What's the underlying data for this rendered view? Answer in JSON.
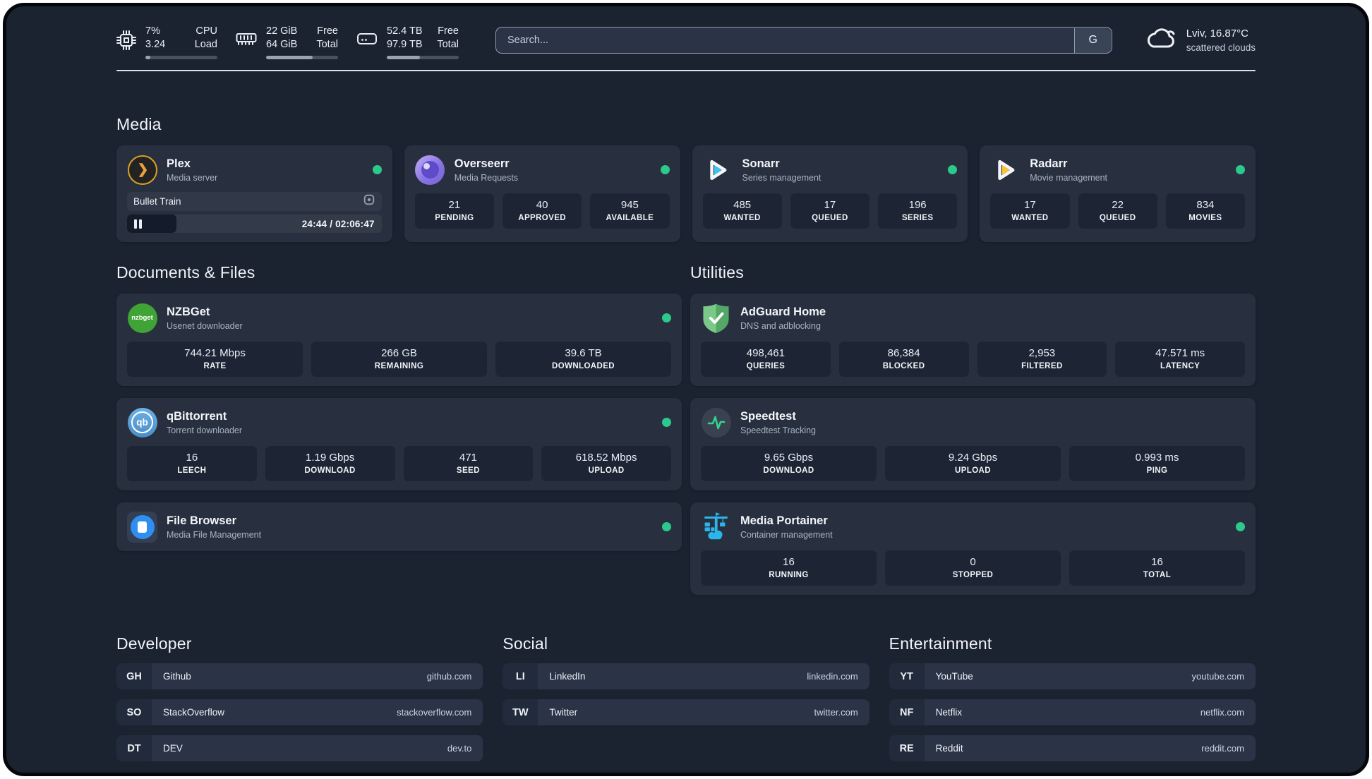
{
  "topbar": {
    "cpu": {
      "values": [
        "7%",
        "3.24"
      ],
      "labels": [
        "CPU",
        "Load"
      ],
      "progress": 7
    },
    "memory": {
      "values": [
        "22 GiB",
        "64 GiB"
      ],
      "labels": [
        "Free",
        "Total"
      ],
      "progress": 65
    },
    "disk": {
      "values": [
        "52.4 TB",
        "97.9 TB"
      ],
      "labels": [
        "Free",
        "Total"
      ],
      "progress": 46
    },
    "search": {
      "placeholder": "Search...",
      "button_label": "G"
    },
    "weather": {
      "location": "Lviv, 16.87°C",
      "condition": "scattered clouds"
    }
  },
  "sections": {
    "media": {
      "title": "Media"
    },
    "documents": {
      "title": "Documents & Files"
    },
    "utilities": {
      "title": "Utilities"
    },
    "developer": {
      "title": "Developer"
    },
    "social": {
      "title": "Social"
    },
    "entertainment": {
      "title": "Entertainment"
    }
  },
  "services": {
    "plex": {
      "name": "Plex",
      "description": "Media server",
      "player": {
        "title": "Bullet Train",
        "time_display": "24:44 / 02:06:47",
        "progress": 19.5
      }
    },
    "overseerr": {
      "name": "Overseerr",
      "description": "Media Requests",
      "stats": [
        {
          "value": "21",
          "label": "PENDING"
        },
        {
          "value": "40",
          "label": "APPROVED"
        },
        {
          "value": "945",
          "label": "AVAILABLE"
        }
      ]
    },
    "sonarr": {
      "name": "Sonarr",
      "description": "Series management",
      "stats": [
        {
          "value": "485",
          "label": "WANTED"
        },
        {
          "value": "17",
          "label": "QUEUED"
        },
        {
          "value": "196",
          "label": "SERIES"
        }
      ]
    },
    "radarr": {
      "name": "Radarr",
      "description": "Movie management",
      "stats": [
        {
          "value": "17",
          "label": "WANTED"
        },
        {
          "value": "22",
          "label": "QUEUED"
        },
        {
          "value": "834",
          "label": "MOVIES"
        }
      ]
    },
    "nzbget": {
      "name": "NZBGet",
      "description": "Usenet downloader",
      "icon_label": "nzbget",
      "stats": [
        {
          "value": "744.21 Mbps",
          "label": "RATE"
        },
        {
          "value": "266 GB",
          "label": "REMAINING"
        },
        {
          "value": "39.6 TB",
          "label": "DOWNLOADED"
        }
      ]
    },
    "qbittorrent": {
      "name": "qBittorrent",
      "description": "Torrent downloader",
      "icon_label": "qb",
      "stats": [
        {
          "value": "16",
          "label": "LEECH"
        },
        {
          "value": "1.19 Gbps",
          "label": "DOWNLOAD"
        },
        {
          "value": "471",
          "label": "SEED"
        },
        {
          "value": "618.52 Mbps",
          "label": "UPLOAD"
        }
      ]
    },
    "filebrowser": {
      "name": "File Browser",
      "description": "Media File Management"
    },
    "adguard": {
      "name": "AdGuard Home",
      "description": "DNS and adblocking",
      "stats": [
        {
          "value": "498,461",
          "label": "QUERIES"
        },
        {
          "value": "86,384",
          "label": "BLOCKED"
        },
        {
          "value": "2,953",
          "label": "FILTERED"
        },
        {
          "value": "47.571 ms",
          "label": "LATENCY"
        }
      ]
    },
    "speedtest": {
      "name": "Speedtest",
      "description": "Speedtest Tracking",
      "stats": [
        {
          "value": "9.65 Gbps",
          "label": "DOWNLOAD"
        },
        {
          "value": "9.24 Gbps",
          "label": "UPLOAD"
        },
        {
          "value": "0.993 ms",
          "label": "PING"
        }
      ]
    },
    "portainer": {
      "name": "Media Portainer",
      "description": "Container management",
      "stats": [
        {
          "value": "16",
          "label": "RUNNING"
        },
        {
          "value": "0",
          "label": "STOPPED"
        },
        {
          "value": "16",
          "label": "TOTAL"
        }
      ]
    }
  },
  "bookmarks": {
    "developer": [
      {
        "abbr": "GH",
        "name": "Github",
        "url": "github.com"
      },
      {
        "abbr": "SO",
        "name": "StackOverflow",
        "url": "stackoverflow.com"
      },
      {
        "abbr": "DT",
        "name": "DEV",
        "url": "dev.to"
      }
    ],
    "social": [
      {
        "abbr": "LI",
        "name": "LinkedIn",
        "url": "linkedin.com"
      },
      {
        "abbr": "TW",
        "name": "Twitter",
        "url": "twitter.com"
      }
    ],
    "entertainment": [
      {
        "abbr": "YT",
        "name": "YouTube",
        "url": "youtube.com"
      },
      {
        "abbr": "NF",
        "name": "Netflix",
        "url": "netflix.com"
      },
      {
        "abbr": "RE",
        "name": "Reddit",
        "url": "reddit.com"
      }
    ]
  },
  "colors": {
    "status_online": "#2bc98c",
    "plex_accent": "#e5a00d"
  }
}
